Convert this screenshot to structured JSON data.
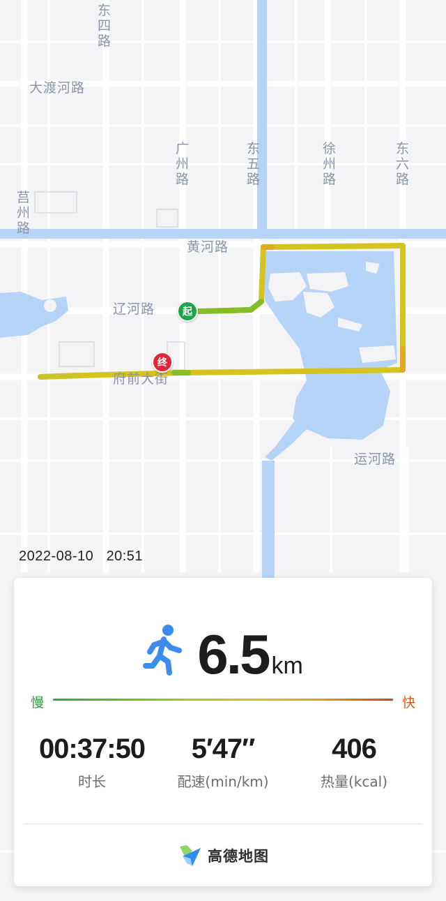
{
  "map": {
    "road_labels": {
      "dongsi": "东四路",
      "dadu": "大渡河路",
      "guangzhou": "广州路",
      "dongwu": "东五路",
      "xuzhou": "徐州路",
      "dongliu": "东六路",
      "juzhou": "莒州路",
      "huanghe": "黄河路",
      "liaohe": "辽河路",
      "fuqian": "府前大街",
      "yunhe": "运河路"
    },
    "start_marker": "起",
    "end_marker": "终",
    "colors": {
      "water": "#b6d4f7",
      "road": "#ffffff",
      "route_yellow": "#d7c21f",
      "route_green": "#8cbc2a",
      "start": "#1ea54a",
      "end": "#e0283a"
    }
  },
  "timestamp": {
    "date": "2022-08-10",
    "time": "20:51"
  },
  "summary": {
    "distance_value": "6.5",
    "distance_unit": "km",
    "pace_scale": {
      "slow": "慢",
      "fast": "快"
    },
    "stats": {
      "duration": {
        "value": "00:37:50",
        "label": "时长"
      },
      "pace": {
        "value": "5′47″",
        "label": "配速(min/km)"
      },
      "calories": {
        "value": "406",
        "label": "热量(kcal)"
      }
    },
    "icon": "running-person-icon",
    "brand": {
      "name": "高德地图",
      "icon": "amap-logo-icon"
    }
  }
}
